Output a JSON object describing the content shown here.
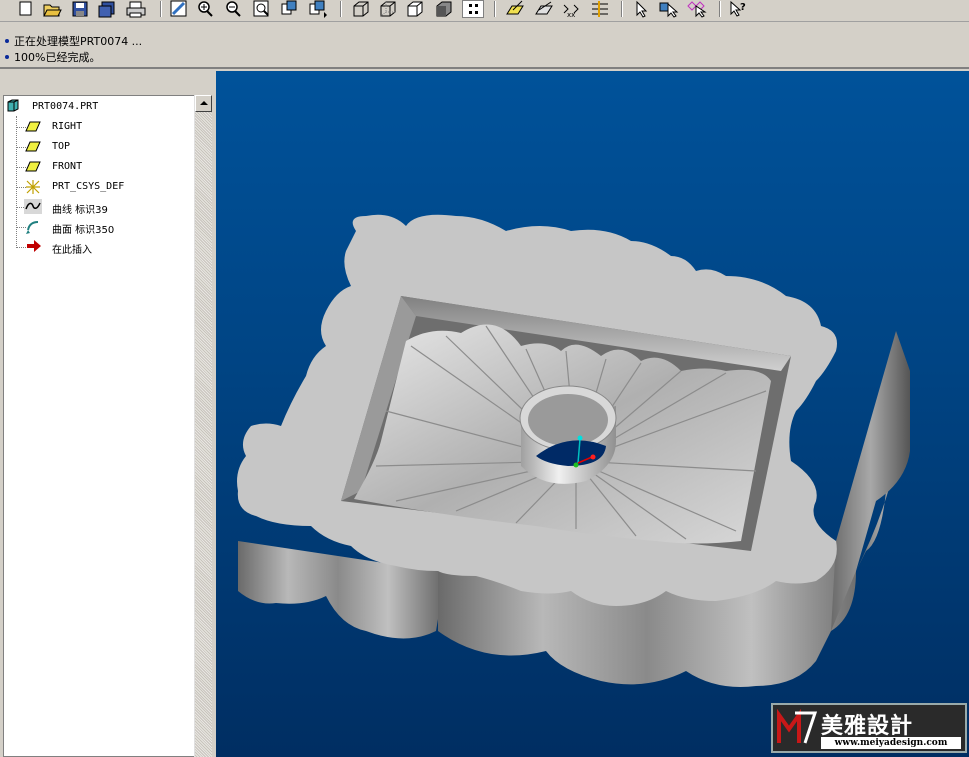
{
  "toolbar": {
    "buttons": [
      "new-icon",
      "open-icon",
      "save-icon",
      "save-copy-icon",
      "print-icon",
      "repaint-icon",
      "zoom-in-icon",
      "zoom-out-icon",
      "refit-icon",
      "orient-icon",
      "saved-views-icon",
      "display-style-icon",
      "model-tree-icon",
      "datum-plane-icon",
      "datum-axis-icon",
      "datum-point-icon",
      "coord-sys-icon",
      "select-icon",
      "query-select-icon",
      "pick-from-list-icon",
      "whats-this-icon"
    ]
  },
  "messages": [
    "正在处理模型PRT0074 ...",
    "100%已经完成。"
  ],
  "tree": {
    "root": "PRT0074.PRT",
    "items": [
      {
        "label": "RIGHT",
        "icon": "datum-plane-icon"
      },
      {
        "label": "TOP",
        "icon": "datum-plane-icon"
      },
      {
        "label": "FRONT",
        "icon": "datum-plane-icon"
      },
      {
        "label": "PRT_CSYS_DEF",
        "icon": "coordinate-system-icon"
      },
      {
        "label": "曲线 标识39",
        "icon": "curve-icon"
      },
      {
        "label": "曲面 标识350",
        "icon": "surface-icon"
      },
      {
        "label": "在此插入",
        "icon": "insert-here-arrow-icon"
      }
    ]
  },
  "watermark": {
    "title": "美雅設計",
    "url": "www.meiyadesign.com"
  },
  "colors": {
    "viewport_top": "#00529a",
    "viewport_bottom": "#002e62",
    "model_face": "#c8c8c8"
  }
}
